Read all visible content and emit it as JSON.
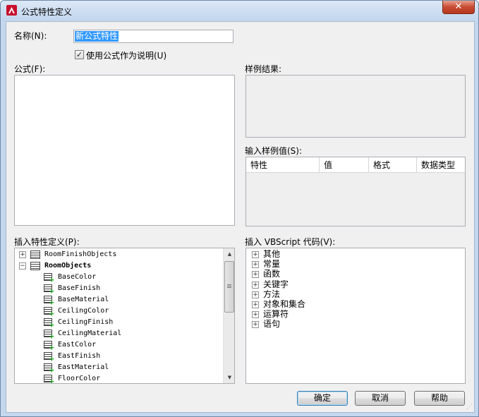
{
  "window": {
    "title": "公式特性定义",
    "close_label": "✕"
  },
  "name_field": {
    "label": "名称(N):",
    "value": "新公式特性"
  },
  "use_formula_checkbox": {
    "label": "使用公式作为说明(U)",
    "checked": true,
    "mark": "✓"
  },
  "formula": {
    "label": "公式(F):"
  },
  "sample_result": {
    "label": "样例结果:"
  },
  "sample_values": {
    "label": "输入样例值(S):",
    "columns": [
      "特性",
      "值",
      "格式",
      "数据类型"
    ]
  },
  "insert_property": {
    "label": "插入特性定义(P):",
    "items": [
      {
        "label": "RoomFinishObjects",
        "level": 0,
        "expander": "+",
        "bold": false
      },
      {
        "label": "RoomObjects",
        "level": 0,
        "expander": "−",
        "bold": true
      },
      {
        "label": "BaseColor",
        "level": 1
      },
      {
        "label": "BaseFinish",
        "level": 1
      },
      {
        "label": "BaseMaterial",
        "level": 1
      },
      {
        "label": "CeilingColor",
        "level": 1
      },
      {
        "label": "CeilingFinish",
        "level": 1
      },
      {
        "label": "CeilingMaterial",
        "level": 1
      },
      {
        "label": "EastColor",
        "level": 1
      },
      {
        "label": "EastFinish",
        "level": 1
      },
      {
        "label": "EastMaterial",
        "level": 1
      },
      {
        "label": "FloorColor",
        "level": 1
      }
    ],
    "scroll_up": "▲",
    "scroll_down": "▼"
  },
  "insert_vbscript": {
    "label": "插入 VBScript 代码(V):",
    "items": [
      "其他",
      "常量",
      "函数",
      "关键字",
      "方法",
      "对象和集合",
      "运算符",
      "语句"
    ],
    "expander": "+"
  },
  "buttons": {
    "ok": "确定",
    "cancel": "取消",
    "help": "帮助"
  },
  "colors": {
    "selection": "#3399ff",
    "title_bar": "#c4d7ee",
    "close_button": "#c74a32",
    "add_icon": "#1e9e1e"
  }
}
